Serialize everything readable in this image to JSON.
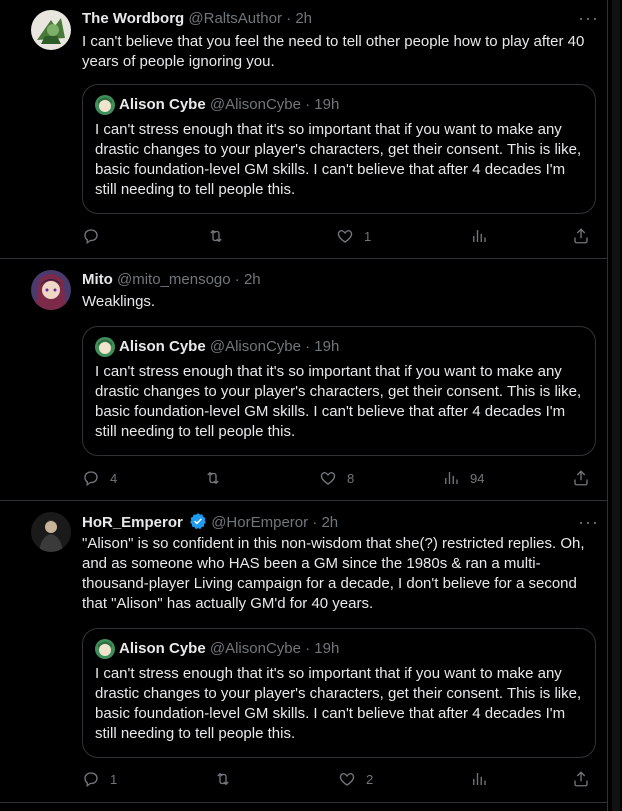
{
  "tweets": [
    {
      "name": "The Wordborg",
      "handle": "@RaltsAuthor · 2h",
      "text": "I can't believe that you feel the need to tell other people how to play after 40 years of people ignoring you.",
      "quote": {
        "name": "Alison Cybe",
        "handle": "@AlisonCybe · 19h",
        "text": "I can't stress enough that it's so important that if you want to make any drastic changes to your player's characters, get their consent. This is like, basic foundation-level GM skills. I can't believe that after 4 decades I'm still needing to tell people this."
      },
      "replies": "",
      "retweets": "",
      "likes": "1",
      "views": ""
    },
    {
      "name": "Mito",
      "handle": "@mito_mensogo · 2h",
      "text": "Weaklings.",
      "quote": {
        "name": "Alison Cybe",
        "handle": "@AlisonCybe · 19h",
        "text": "I can't stress enough that it's so important that if you want to make any drastic changes to your player's characters, get their consent. This is like, basic foundation-level GM skills. I can't believe that after 4 decades I'm still needing to tell people this."
      },
      "replies": "4",
      "retweets": "",
      "likes": "8",
      "views": "94"
    },
    {
      "name": "HoR_Emperor",
      "handle": "@HorEmperor · 2h",
      "text": "\"Alison\" is so confident in this non-wisdom that she(?) restricted replies. Oh, and as someone who HAS been a GM since the 1980s & ran a multi-thousand-player Living campaign for a decade, I don't believe for a second that \"Alison\" has actually GM'd for 40 years.",
      "quote": {
        "name": "Alison Cybe",
        "handle": "@AlisonCybe · 19h",
        "text": "I can't stress enough that it's so important that if you want to make any drastic changes to your player's characters, get their consent. This is like, basic foundation-level GM skills. I can't believe that after 4 decades I'm still needing to tell people this."
      },
      "replies": "1",
      "retweets": "",
      "likes": "2",
      "views": ""
    }
  ],
  "colors": {
    "background": "#000000",
    "text": "#e7e9ea",
    "secondary": "#71767b",
    "border": "#2f3336",
    "verified": "#1d9bf0"
  },
  "icons": [
    "more-icon",
    "reply-icon",
    "retweet-icon",
    "like-icon",
    "views-icon",
    "share-icon",
    "verified-icon"
  ]
}
